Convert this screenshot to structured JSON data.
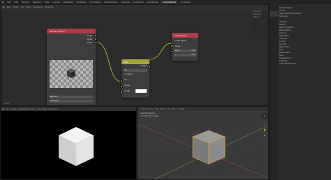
{
  "topbar": {
    "menus": [
      "File",
      "Edit",
      "Render",
      "Window",
      "Help"
    ],
    "workspaces": [
      "Layout",
      "Modeling",
      "Sculpting",
      "UV Editing",
      "Texture Paint",
      "Shading",
      "Animation",
      "Rendering",
      "Compositing",
      "Scripting"
    ],
    "active_workspace": "Compositing"
  },
  "node_editor": {
    "header": [
      "View",
      "Select",
      "Add",
      "Node",
      "Use Nodes",
      "Backdrop"
    ],
    "tools": [
      "Active Tool",
      "Select Box",
      "Options"
    ],
    "nodes": {
      "render_layers": {
        "title": "Render Layers",
        "outputs": [
          "Image",
          "Alpha",
          "Noise"
        ],
        "scene": "Scene",
        "layer": "ViewLayer"
      },
      "mix": {
        "title": "Mix",
        "output": "Image",
        "blend": "Mix",
        "clamp": "Clamp",
        "inputs": [
          "Fac",
          "Image",
          "Image"
        ]
      },
      "composite": {
        "title": "Composite",
        "use_alpha": "Use Alpha",
        "inputs": [
          "Image",
          "Alpha",
          "Z"
        ],
        "alpha_value": "1.000",
        "z_value": "1.000"
      }
    },
    "footer": "Scene"
  },
  "properties": {
    "items": [
      "Render Engine",
      "Device",
      "Open Shading Language",
      "Sampling",
      "",
      "Viewport",
      "Render",
      "Noise Threshold",
      "Max Samples",
      "Denoise",
      "Light Paths",
      "Volumes",
      "Curves",
      "Simplify",
      "Motion Blur",
      "Film",
      "Performance",
      "Bake",
      "Grease Pencil",
      "Freestyle",
      "Color Management"
    ]
  },
  "image_editor": {
    "header": [
      "View",
      "Image",
      "Render Result",
      "Slot 1",
      "View Layer",
      "Combined"
    ]
  },
  "viewport": {
    "header": [
      "Object Mode",
      "View",
      "Select",
      "Add",
      "Object",
      "Global"
    ],
    "overlay_line1": "User Perspective",
    "overlay_line2": "(1) Collection | Cube"
  },
  "colors": {
    "render_layers_header": "#b03a48",
    "mix_header": "#a4a43c",
    "composite_header": "#b03a48",
    "link": "#c7c729",
    "axis_x": "#b94653",
    "axis_y": "#7fa33d",
    "selection": "#e8a13d"
  }
}
